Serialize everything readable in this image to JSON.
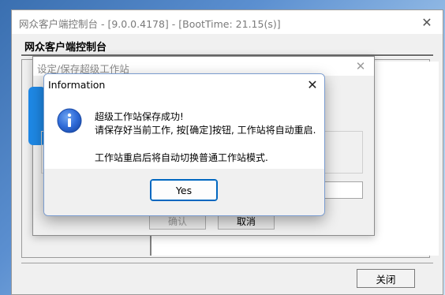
{
  "main_window": {
    "title": "网众客户端控制台 - [9.0.0.4178] - [BootTime: 21.15(s)]",
    "heading": "网众客户端控制台",
    "close_button_label": "关闭",
    "close_icon": "close-icon"
  },
  "mid_dialog": {
    "title": "设定/保存超级工作站",
    "ok_label": "确认",
    "cancel_label": "取消",
    "close_icon": "close-icon"
  },
  "info_dialog": {
    "title": "Information",
    "message_line1": "超级工作站保存成功!",
    "message_line2": "请保存好当前工作, 按[确定]按钮, 工作站将自动重启.",
    "message_line3": "工作站重启后将自动切换普通工作站模式.",
    "yes_label": "Yes",
    "icon": "information-icon",
    "close_icon": "close-icon"
  },
  "colors": {
    "accent": "#0067c0",
    "info_icon_blue": "#2f6bd8",
    "desktop": "#5b8fd0"
  }
}
